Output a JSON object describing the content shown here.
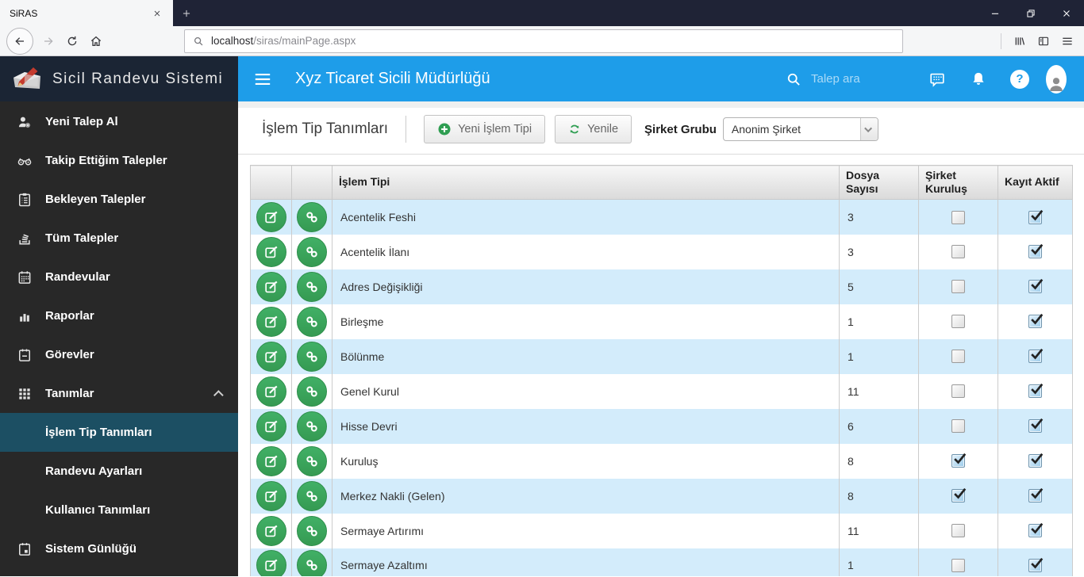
{
  "browser": {
    "tab_title": "SiRAS",
    "url": {
      "host": "localhost",
      "path": "/siras/mainPage.aspx"
    }
  },
  "sidebar": {
    "brand": "Sicil Randevu Sistemi",
    "items": [
      {
        "label": "Yeni Talep Al",
        "icon": "user-gear"
      },
      {
        "label": "Takip Ettiğim Talepler",
        "icon": "binoculars"
      },
      {
        "label": "Bekleyen Talepler",
        "icon": "clipboard"
      },
      {
        "label": "Tüm Talepler",
        "icon": "stack"
      },
      {
        "label": "Randevular",
        "icon": "calendar"
      },
      {
        "label": "Raporlar",
        "icon": "chart"
      },
      {
        "label": "Görevler",
        "icon": "note"
      },
      {
        "label": "Tanımlar",
        "icon": "grid",
        "expanded": true
      },
      {
        "label": "İşlem Tip Tanımları",
        "sub": true,
        "active": true
      },
      {
        "label": "Randevu Ayarları",
        "sub": true
      },
      {
        "label": "Kullanıcı Tanımları",
        "sub": true
      },
      {
        "label": "Sistem Günlüğü",
        "icon": "journal"
      }
    ]
  },
  "header": {
    "title": "Xyz Ticaret Sicili Müdürlüğü",
    "search_placeholder": "Talep ara",
    "help_glyph": "?"
  },
  "toolbar": {
    "page_title": "İşlem Tip Tanımları",
    "new_button_label": "Yeni İşlem Tipi",
    "refresh_button_label": "Yenile",
    "group_label": "Şirket Grubu",
    "group_value": "Anonim Şirket"
  },
  "table": {
    "headers": [
      "İşlem Tipi",
      "Dosya Sayısı",
      "Şirket Kuruluş",
      "Kayıt Aktif"
    ],
    "rows": [
      {
        "islem_tipi": "Acentelik Feshi",
        "dosya_sayisi": "3",
        "sirket_kurulus": false,
        "kayit_aktif": true
      },
      {
        "islem_tipi": "Acentelik İlanı",
        "dosya_sayisi": "3",
        "sirket_kurulus": false,
        "kayit_aktif": true
      },
      {
        "islem_tipi": "Adres Değişikliği",
        "dosya_sayisi": "5",
        "sirket_kurulus": false,
        "kayit_aktif": true
      },
      {
        "islem_tipi": "Birleşme",
        "dosya_sayisi": "1",
        "sirket_kurulus": false,
        "kayit_aktif": true
      },
      {
        "islem_tipi": "Bölünme",
        "dosya_sayisi": "1",
        "sirket_kurulus": false,
        "kayit_aktif": true
      },
      {
        "islem_tipi": "Genel Kurul",
        "dosya_sayisi": "11",
        "sirket_kurulus": false,
        "kayit_aktif": true
      },
      {
        "islem_tipi": "Hisse Devri",
        "dosya_sayisi": "6",
        "sirket_kurulus": false,
        "kayit_aktif": true
      },
      {
        "islem_tipi": "Kuruluş",
        "dosya_sayisi": "8",
        "sirket_kurulus": true,
        "kayit_aktif": true
      },
      {
        "islem_tipi": "Merkez Nakli (Gelen)",
        "dosya_sayisi": "8",
        "sirket_kurulus": true,
        "kayit_aktif": true
      },
      {
        "islem_tipi": "Sermaye Artırımı",
        "dosya_sayisi": "11",
        "sirket_kurulus": false,
        "kayit_aktif": true
      },
      {
        "islem_tipi": "Sermaye Azaltımı",
        "dosya_sayisi": "1",
        "sirket_kurulus": false,
        "kayit_aktif": true
      }
    ]
  },
  "colors": {
    "accent_blue": "#1e9de9",
    "button_green": "#3aa55c",
    "row_highlight": "#d3ecfb",
    "sidebar_active": "#1c4f63",
    "titlebar": "#1f2336"
  }
}
